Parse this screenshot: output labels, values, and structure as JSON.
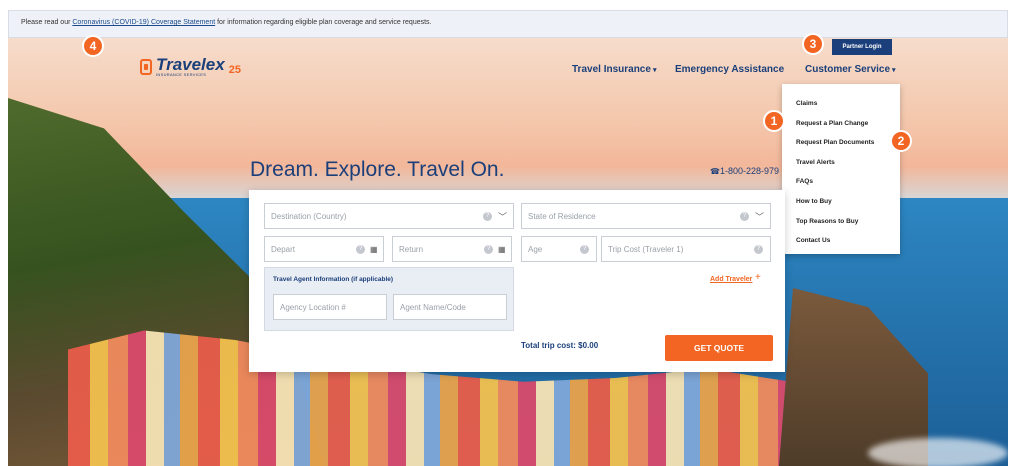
{
  "notice": {
    "prefix": "Please read our ",
    "link": "Coronavirus (COVID-19) Coverage Statement",
    "suffix": " for information regarding eligible plan coverage and service requests."
  },
  "logo": {
    "word": "Travelex",
    "sub": "INSURANCE SERVICES",
    "anniversary": "25"
  },
  "nav": {
    "travel_insurance": "Travel Insurance",
    "emergency_assistance": "Emergency Assistance",
    "customer_service": "Customer Service",
    "partner_login": "Partner Login"
  },
  "dropdown": {
    "items": [
      "Claims",
      "Request a Plan Change",
      "Request Plan Documents",
      "Travel Alerts",
      "FAQs",
      "How to Buy",
      "Top Reasons to Buy",
      "Contact Us"
    ]
  },
  "badges": {
    "b1": "1",
    "b2": "2",
    "b3": "3",
    "b4": "4"
  },
  "hero": {
    "headline": "Dream. Explore. Travel On.",
    "phone": "1-800-228-979"
  },
  "form": {
    "destination": "Destination (Country)",
    "state": "State of Residence",
    "depart": "Depart",
    "return": "Return",
    "age": "Age",
    "trip_cost": "Trip Cost (Traveler 1)",
    "agent_title": "Travel Agent Information (if applicable)",
    "agency_location": "Agency Location #",
    "agent_name": "Agent Name/Code",
    "add_traveler": "Add Traveler",
    "total": "Total trip cost: $0.00",
    "get_quote": "GET QUOTE"
  },
  "colors": {
    "brand_navy": "#1b3f7a",
    "brand_orange": "#f26522"
  }
}
